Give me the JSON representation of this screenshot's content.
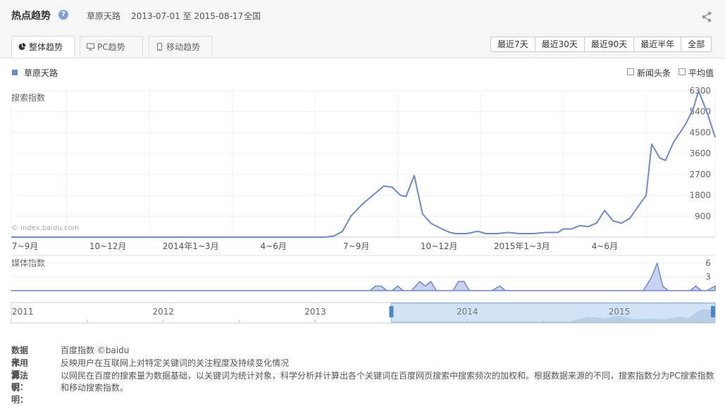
{
  "header": {
    "title": "热点趋势",
    "help_glyph": "?",
    "keyword": "草原天路",
    "date_range": "2013-07-01 至 2015-08-17",
    "region": "全国"
  },
  "tabs": [
    {
      "label": "整体趋势",
      "icon": "pie-chart-icon",
      "active": true
    },
    {
      "label": "PC趋势",
      "icon": "monitor-icon",
      "active": false
    },
    {
      "label": "移动趋势",
      "icon": "mobile-icon",
      "active": false
    }
  ],
  "periods": [
    "最近7天",
    "最近30天",
    "最近90天",
    "最近半年",
    "全部"
  ],
  "legend": {
    "series_name": "草原天路",
    "color": "#6f89cf"
  },
  "options": {
    "news": "新闻头条",
    "average": "平均值"
  },
  "watermark": "© index.baidu.com",
  "chart_data": [
    {
      "type": "line",
      "ylabel": "搜索指数",
      "ylim": [
        0,
        6300
      ],
      "yticks": [
        900,
        1800,
        2700,
        3600,
        4500,
        5400,
        6300
      ],
      "x_domain": [
        0,
        25.5
      ],
      "xtick_positions": [
        0.5,
        3.5,
        6.5,
        9.5,
        12.5,
        15.5,
        18.5,
        21.5
      ],
      "xtick_labels": [
        "7~9月",
        "10~12月",
        "2014年1~3月",
        "4~6月",
        "7~9月",
        "10~12月",
        "2015年1~3月",
        "4~6月"
      ],
      "grid": true,
      "series": [
        {
          "name": "草原天路",
          "x": [
            0,
            11.4,
            11.7,
            12.0,
            12.3,
            12.7,
            13.2,
            13.5,
            13.8,
            14.1,
            14.3,
            14.6,
            14.9,
            15.2,
            15.6,
            15.9,
            16.1,
            16.5,
            16.9,
            17.2,
            17.6,
            18.0,
            18.4,
            18.9,
            19.4,
            19.8,
            20.0,
            20.3,
            20.6,
            20.9,
            21.2,
            21.5,
            21.8,
            22.1,
            22.4,
            22.7,
            23.0,
            23.2,
            23.5,
            23.7,
            24.0,
            24.4,
            24.7,
            24.9,
            25.2,
            25.5
          ],
          "y": [
            0,
            0,
            50,
            250,
            900,
            1400,
            1900,
            2200,
            2150,
            1800,
            1750,
            2650,
            1000,
            600,
            350,
            200,
            150,
            150,
            250,
            150,
            150,
            200,
            150,
            150,
            200,
            200,
            350,
            350,
            500,
            450,
            600,
            1150,
            700,
            600,
            800,
            1300,
            1800,
            4000,
            3400,
            3300,
            4100,
            4800,
            5500,
            6300,
            5400,
            4300
          ]
        }
      ]
    },
    {
      "type": "area",
      "ylabel": "媒体指数",
      "ylim": [
        0,
        6
      ],
      "yticks": [
        3,
        6
      ],
      "x_domain": [
        0,
        25.5
      ],
      "series": [
        {
          "name": "草原天路",
          "x": [
            0,
            13.0,
            13.2,
            13.4,
            13.6,
            13.8,
            14.0,
            14.2,
            14.5,
            14.8,
            15.0,
            15.2,
            15.4,
            15.6,
            16.0,
            16.2,
            16.4,
            16.6,
            17.4,
            17.7,
            17.9,
            22.9,
            23.2,
            23.4,
            23.6,
            23.8,
            24.0,
            24.6,
            24.8,
            25.0,
            25.2,
            25.5
          ],
          "y": [
            0,
            0,
            1,
            1,
            0,
            0,
            1,
            0,
            0,
            2,
            1,
            2,
            0,
            0,
            0,
            2,
            2,
            0,
            0,
            1,
            0,
            0,
            3,
            6,
            1,
            0,
            0,
            0,
            1,
            0,
            0,
            1
          ]
        }
      ]
    },
    {
      "type": "area",
      "ylabel": "",
      "x_domain": [
        2011,
        2015.63
      ],
      "ylim": [
        0,
        1
      ],
      "xtick_labels": [
        "2011",
        "2012",
        "2013",
        "2014",
        "2015"
      ],
      "xtick_positions": [
        2011,
        2012,
        2013,
        2014,
        2015
      ],
      "brush": [
        2013.5,
        2015.63
      ],
      "series": [
        {
          "name": "",
          "x": [
            2011,
            2014.65,
            2014.8,
            2014.9,
            2015.0,
            2015.1,
            2015.2,
            2015.3,
            2015.4,
            2015.45,
            2015.5,
            2015.55,
            2015.63
          ],
          "y": [
            0,
            0,
            0.3,
            0.2,
            0.35,
            0.15,
            0.2,
            0.15,
            0.3,
            0.2,
            0.5,
            0.7,
            0.6
          ]
        }
      ]
    }
  ],
  "footer": [
    {
      "label": "数据来源：",
      "text": "百度指数 ©baidu"
    },
    {
      "label": "作用说明：",
      "text": "反映用户在互联网上对特定关键词的关注程度及持续变化情况"
    },
    {
      "label": "算法说明：",
      "text": "以网民在百度的搜索量为数据基础，以关键词为统计对象，科学分析并计算出各个关键词在百度网页搜索中搜索频次的加权和。根据数据来源的不同，搜索指数分为PC搜索指数和移动搜索指数。"
    }
  ]
}
